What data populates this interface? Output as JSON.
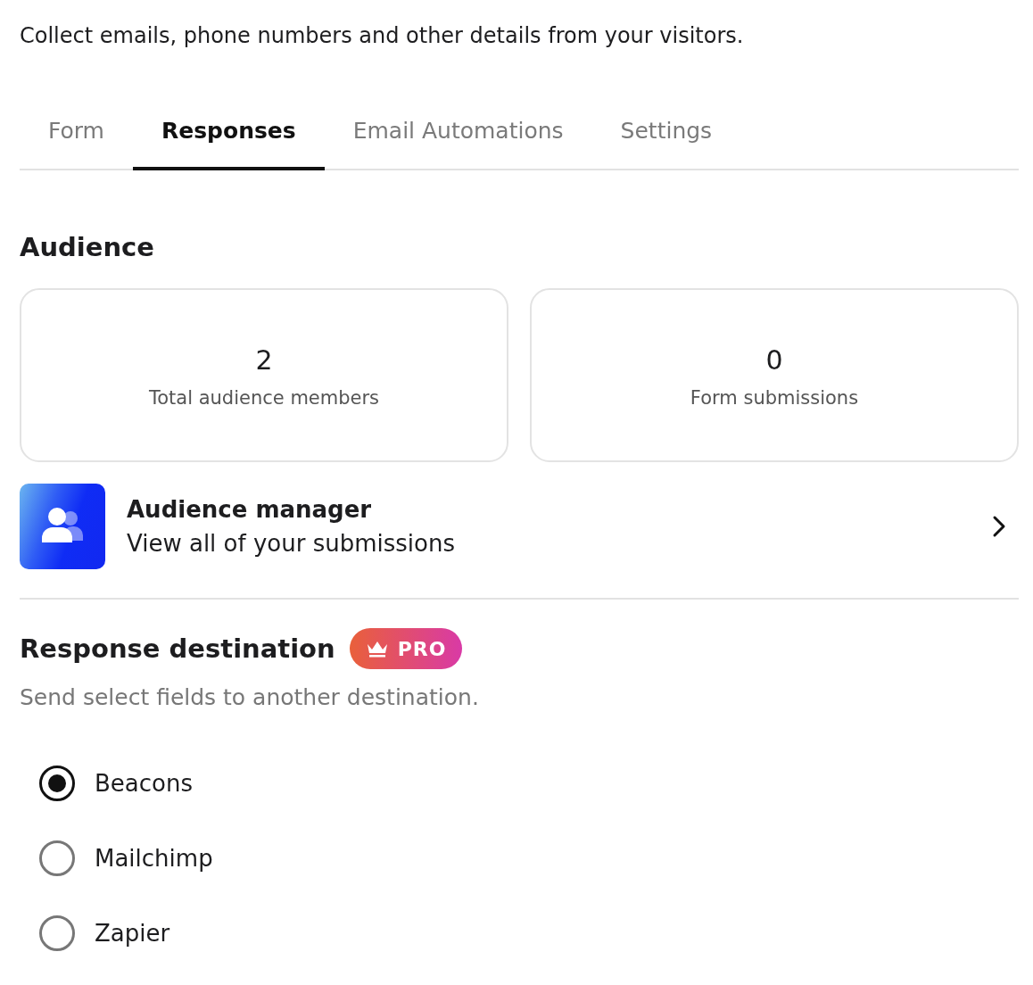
{
  "intro": "Collect emails, phone numbers and other details from your visitors.",
  "tabs": [
    {
      "label": "Form",
      "selected": false
    },
    {
      "label": "Responses",
      "selected": true
    },
    {
      "label": "Email Automations",
      "selected": false
    },
    {
      "label": "Settings",
      "selected": false
    }
  ],
  "audience": {
    "title": "Audience",
    "stats": [
      {
        "value": "2",
        "label": "Total audience members"
      },
      {
        "value": "0",
        "label": "Form submissions"
      }
    ],
    "manager": {
      "title": "Audience manager",
      "subtitle": "View all of your submissions"
    }
  },
  "destination": {
    "title": "Response destination",
    "badge": "PRO",
    "description": "Send select fields to another destination.",
    "options": [
      {
        "label": "Beacons",
        "selected": true
      },
      {
        "label": "Mailchimp",
        "selected": false
      },
      {
        "label": "Zapier",
        "selected": false
      }
    ]
  }
}
